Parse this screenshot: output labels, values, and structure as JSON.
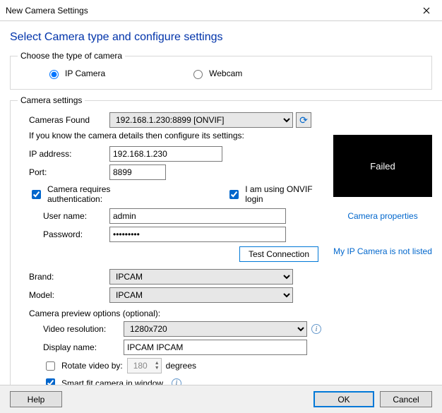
{
  "window": {
    "title": "New Camera Settings"
  },
  "headline": "Select Camera type and configure settings",
  "typeGroup": {
    "legend": "Choose the type of camera",
    "ip": "IP Camera",
    "webcam": "Webcam"
  },
  "settingsGroup": {
    "legend": "Camera settings",
    "camerasFoundLabel": "Cameras Found",
    "camerasFoundValue": "192.168.1.230:8899 [ONVIF]",
    "hintText": "If you know the camera details then configure its settings:",
    "ipLabel": "IP address:",
    "ipValue": "192.168.1.230",
    "portLabel": "Port:",
    "portValue": "8899",
    "requiresAuth": "Camera requires authentication:",
    "onvifLogin": "I am using ONVIF login",
    "userLabel": "User name:",
    "userValue": "admin",
    "passLabel": "Password:",
    "passValue": "•••••••••",
    "testBtn": "Test Connection",
    "brandLabel": "Brand:",
    "brandValue": "IPCAM",
    "modelLabel": "Model:",
    "modelValue": "IPCAM",
    "previewHeading": "Camera preview options (optional):",
    "resLabel": "Video resolution:",
    "resValue": "1280x720",
    "displayLabel": "Display name:",
    "displayValue": "IPCAM IPCAM",
    "rotateLabel": "Rotate video by:",
    "rotateValue": "180",
    "rotateUnit": "degrees",
    "smartFit": "Smart fit camera in window",
    "previewStatus": "Failed",
    "propsLink": "Camera properties",
    "notListedLink": "My IP Camera is not listed"
  },
  "buttons": {
    "help": "Help",
    "ok": "OK",
    "cancel": "Cancel"
  }
}
